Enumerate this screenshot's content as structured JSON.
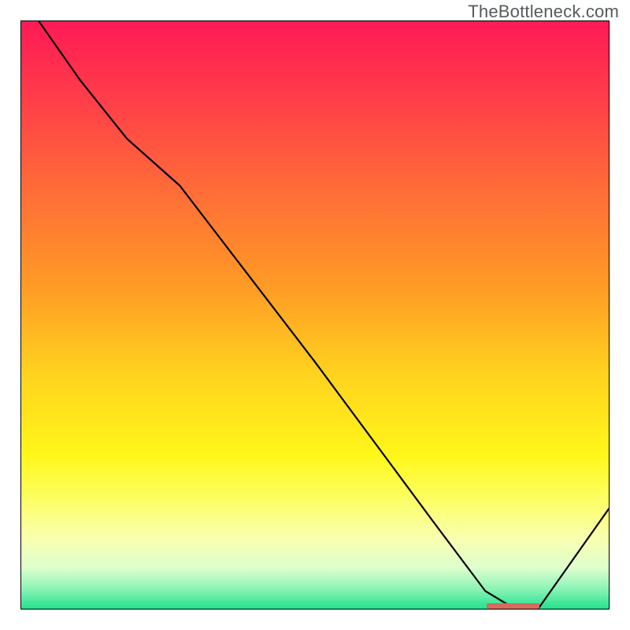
{
  "watermark": "TheBottleneck.com",
  "colors": {
    "gradient_stops": [
      {
        "offset": 0.0,
        "color": "#ff1a55"
      },
      {
        "offset": 0.12,
        "color": "#ff3a4a"
      },
      {
        "offset": 0.28,
        "color": "#ff6a38"
      },
      {
        "offset": 0.45,
        "color": "#ff9a26"
      },
      {
        "offset": 0.6,
        "color": "#ffd21e"
      },
      {
        "offset": 0.74,
        "color": "#fff71a"
      },
      {
        "offset": 0.82,
        "color": "#fcff6a"
      },
      {
        "offset": 0.88,
        "color": "#f9ffb0"
      },
      {
        "offset": 0.93,
        "color": "#deffcd"
      },
      {
        "offset": 0.965,
        "color": "#8ef4b7"
      },
      {
        "offset": 1.0,
        "color": "#25e28e"
      }
    ],
    "curve": "#000000",
    "border": "#000000",
    "marker": "#d66a5f"
  },
  "chart_data": {
    "type": "line",
    "title": "",
    "xlabel": "",
    "ylabel": "",
    "xlim": [
      0,
      100
    ],
    "ylim": [
      0,
      100
    ],
    "grid": false,
    "legend": false,
    "x": [
      3,
      10,
      18,
      27,
      50,
      70,
      79,
      84,
      88,
      100
    ],
    "values": [
      100,
      90,
      80,
      72,
      42,
      15,
      3,
      0,
      0,
      17
    ],
    "minimum_band": {
      "x_start": 79,
      "x_end": 88,
      "y": 0
    }
  }
}
